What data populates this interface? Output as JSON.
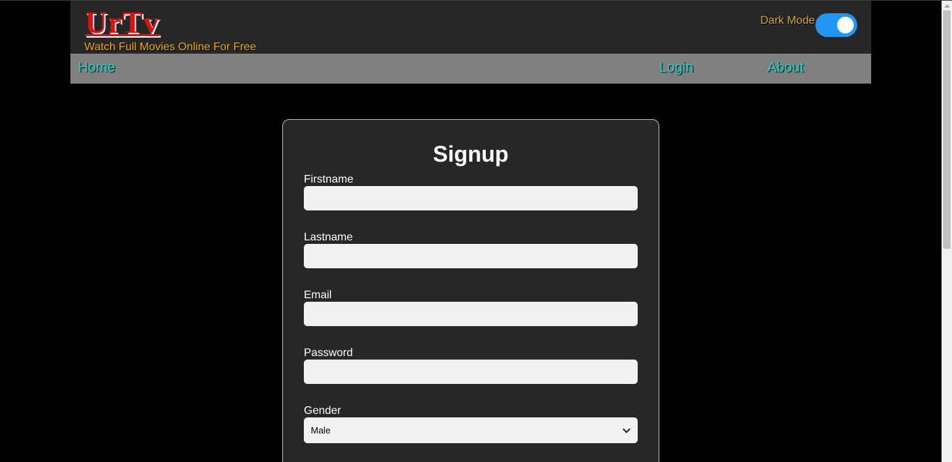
{
  "header": {
    "logo": "UrTv",
    "tagline": "Watch Full Movies Online For Free",
    "dark_mode_label": "Dark Mode",
    "dark_mode_on": true
  },
  "nav": {
    "home": "Home",
    "login": "Login",
    "about": "About"
  },
  "form": {
    "title": "Signup",
    "firstname_label": "Firstname",
    "firstname_value": "",
    "lastname_label": "Lastname",
    "lastname_value": "",
    "email_label": "Email",
    "email_value": "",
    "password_label": "Password",
    "password_value": "",
    "gender_label": "Gender",
    "gender_selected": "Male"
  },
  "colors": {
    "page_bg": "#000000",
    "header_bg": "#272727",
    "nav_bg": "#808080",
    "logo": "#e01010",
    "tagline": "#f0a800",
    "nav_link": "#1ed3c5",
    "toggle_on": "#2196f3",
    "card_bg": "#272727",
    "input_bg": "#f1f1f1"
  }
}
